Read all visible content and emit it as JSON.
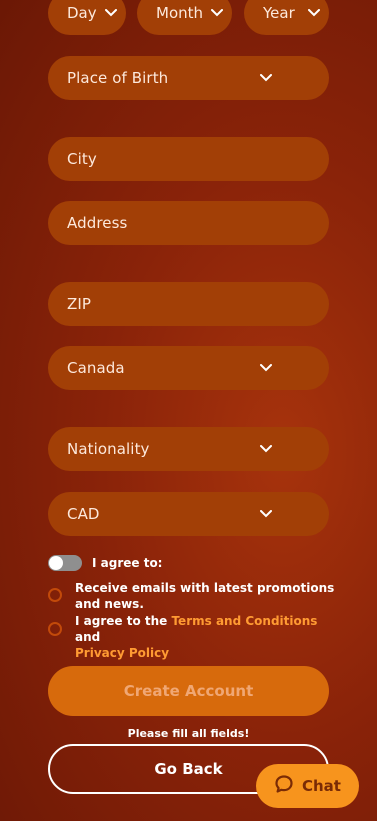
{
  "date_of_birth": {
    "day_placeholder": "Day",
    "month_placeholder": "Month",
    "year_placeholder": "Year"
  },
  "place_of_birth": {
    "placeholder": "Place of Birth"
  },
  "city": {
    "placeholder": "City"
  },
  "address": {
    "placeholder": "Address"
  },
  "zip": {
    "placeholder": "ZIP"
  },
  "country": {
    "value": "Canada"
  },
  "nationality": {
    "placeholder": "Nationality"
  },
  "currency": {
    "value": "CAD"
  },
  "agreements": {
    "toggle_label": "I agree to:",
    "emails_label": "Receive emails with latest promotions and news.",
    "terms_prefix": "I agree to the ",
    "terms_link": "Terms and Conditions",
    "terms_and": " and",
    "privacy_link": "Privacy Policy"
  },
  "actions": {
    "create_label": "Create Account",
    "hint": "Please fill all fields!",
    "back_label": "Go Back"
  },
  "chat": {
    "label": "Chat"
  },
  "colors": {
    "field_bg": "#a23f06",
    "accent_orange": "#d76a0c",
    "link": "#ff9b33",
    "chat_bg": "#f7941d"
  },
  "icons": {
    "select_arrow": "chevron-down-icon",
    "chat": "chat-bubble-icon"
  }
}
